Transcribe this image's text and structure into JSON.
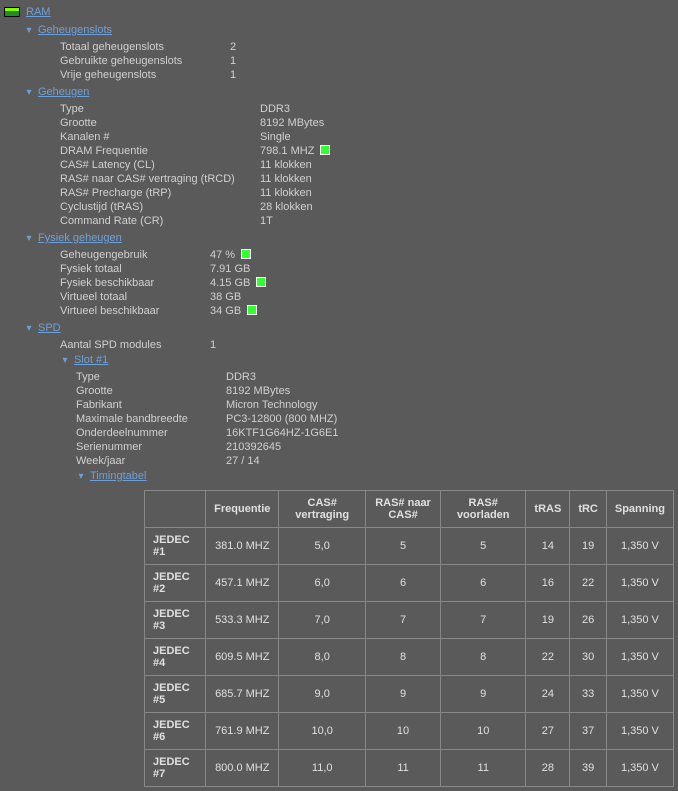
{
  "title": "RAM",
  "sections": {
    "geheugenslots": {
      "title": "Geheugenslots",
      "rows": [
        {
          "label": "Totaal geheugenslots",
          "value": "2"
        },
        {
          "label": "Gebruikte geheugenslots",
          "value": "1"
        },
        {
          "label": "Vrije geheugenslots",
          "value": "1"
        }
      ]
    },
    "geheugen": {
      "title": "Geheugen",
      "rows": [
        {
          "label": "Type",
          "value": "DDR3"
        },
        {
          "label": "Grootte",
          "value": "8192 MBytes"
        },
        {
          "label": "Kanalen #",
          "value": "Single"
        },
        {
          "label": "DRAM Frequentie",
          "value": "798.1 MHZ",
          "indicator": true
        },
        {
          "label": "CAS# Latency (CL)",
          "value": "11 klokken"
        },
        {
          "label": "RAS# naar CAS# vertraging (tRCD)",
          "value": "11 klokken"
        },
        {
          "label": "RAS# Precharge (tRP)",
          "value": "11 klokken"
        },
        {
          "label": "Cyclustijd (tRAS)",
          "value": "28 klokken"
        },
        {
          "label": "Command Rate (CR)",
          "value": "1T"
        }
      ]
    },
    "fysiek": {
      "title": "Fysiek geheugen",
      "rows": [
        {
          "label": "Geheugengebruik",
          "value": "47 %",
          "indicator": true
        },
        {
          "label": "Fysiek totaal",
          "value": "7.91 GB"
        },
        {
          "label": "Fysiek beschikbaar",
          "value": "4.15 GB",
          "indicator": true
        },
        {
          "label": "Virtueel totaal",
          "value": "38 GB"
        },
        {
          "label": "Virtueel beschikbaar",
          "value": "34 GB",
          "indicator": true
        }
      ]
    },
    "spd": {
      "title": "SPD",
      "modules_label": "Aantal SPD modules",
      "modules_value": "1",
      "slot": {
        "title": "Slot #1",
        "rows": [
          {
            "label": "Type",
            "value": "DDR3"
          },
          {
            "label": "Grootte",
            "value": "8192 MBytes"
          },
          {
            "label": "Fabrikant",
            "value": "Micron Technology"
          },
          {
            "label": "Maximale bandbreedte",
            "value": "PC3-12800 (800 MHZ)"
          },
          {
            "label": "Onderdeelnummer",
            "value": "16KTF1G64HZ-1G6E1"
          },
          {
            "label": "Serienummer",
            "value": "210392645"
          },
          {
            "label": "Week/jaar",
            "value": "27 / 14"
          }
        ],
        "timing_title": "Timingtabel"
      }
    }
  },
  "timing": {
    "headers": [
      "",
      "Frequentie",
      "CAS# vertraging",
      "RAS# naar CAS#",
      "RAS# voorladen",
      "tRAS",
      "tRC",
      "Spanning"
    ],
    "rows": [
      [
        "JEDEC #1",
        "381.0 MHZ",
        "5,0",
        "5",
        "5",
        "14",
        "19",
        "1,350 V"
      ],
      [
        "JEDEC #2",
        "457.1 MHZ",
        "6,0",
        "6",
        "6",
        "16",
        "22",
        "1,350 V"
      ],
      [
        "JEDEC #3",
        "533.3 MHZ",
        "7,0",
        "7",
        "7",
        "19",
        "26",
        "1,350 V"
      ],
      [
        "JEDEC #4",
        "609.5 MHZ",
        "8,0",
        "8",
        "8",
        "22",
        "30",
        "1,350 V"
      ],
      [
        "JEDEC #5",
        "685.7 MHZ",
        "9,0",
        "9",
        "9",
        "24",
        "33",
        "1,350 V"
      ],
      [
        "JEDEC #6",
        "761.9 MHZ",
        "10,0",
        "10",
        "10",
        "27",
        "37",
        "1,350 V"
      ],
      [
        "JEDEC #7",
        "800.0 MHZ",
        "11,0",
        "11",
        "11",
        "28",
        "39",
        "1,350 V"
      ]
    ]
  }
}
